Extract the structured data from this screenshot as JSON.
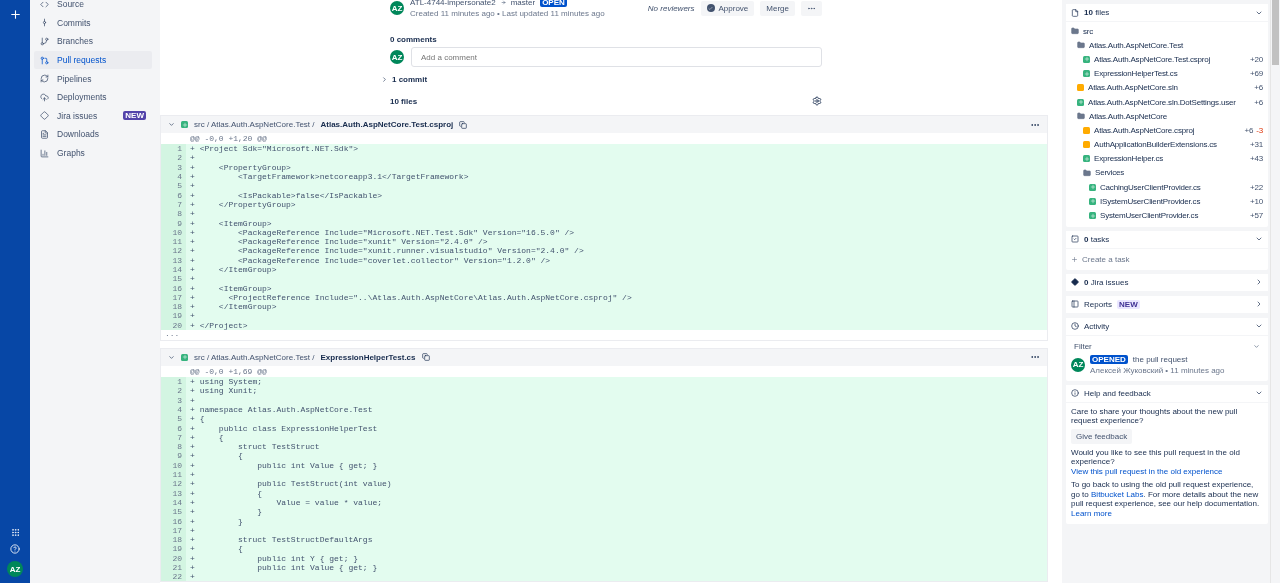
{
  "global_nav": {
    "avatar": "AZ"
  },
  "nav": {
    "items": [
      {
        "label": "Source",
        "selected": false
      },
      {
        "label": "Commits",
        "selected": false
      },
      {
        "label": "Branches",
        "selected": false
      },
      {
        "label": "Pull requests",
        "selected": true
      },
      {
        "label": "Pipelines",
        "selected": false
      },
      {
        "label": "Deployments",
        "selected": false
      },
      {
        "label": "Jira issues",
        "selected": false,
        "badge": "NEW"
      },
      {
        "label": "Downloads",
        "selected": false
      },
      {
        "label": "Graphs",
        "selected": false
      }
    ]
  },
  "pr": {
    "avatar": "AZ",
    "source_branch": "ATL-4744-impersonate2",
    "target_branch": "master",
    "status": "OPEN",
    "meta": "Created 11 minutes ago • Last updated 11 minutes ago",
    "reviewers": "No reviewers",
    "approve": "Approve",
    "merge": "Merge"
  },
  "comments": {
    "count": "0 comments",
    "avatar": "AZ",
    "placeholder": "Add a comment"
  },
  "commits": {
    "label": "1 commit",
    "expanded": false
  },
  "files_count": "10 files",
  "diffs": [
    {
      "breadcrumb": "src / Atlas.Auth.AspNetCore.Test /",
      "file": "Atlas.Auth.AspNetCore.Test.csproj",
      "expanded": true,
      "hunk": "@@ -0,0 +1,20 @@",
      "more": "...",
      "lines": [
        {
          "n": "1",
          "sign": "+",
          "code": "<Project Sdk=\"Microsoft.NET.Sdk\">"
        },
        {
          "n": "2",
          "sign": "+"
        },
        {
          "n": "3",
          "sign": "+",
          "code": "    <PropertyGroup>"
        },
        {
          "n": "4",
          "sign": "+",
          "code": "        <TargetFramework>netcoreapp3.1</TargetFramework>"
        },
        {
          "n": "5",
          "sign": "+"
        },
        {
          "n": "6",
          "sign": "+",
          "code": "        <IsPackable>false</IsPackable>"
        },
        {
          "n": "7",
          "sign": "+",
          "code": "    </PropertyGroup>"
        },
        {
          "n": "8",
          "sign": "+"
        },
        {
          "n": "9",
          "sign": "+",
          "code": "    <ItemGroup>"
        },
        {
          "n": "10",
          "sign": "+",
          "code": "        <PackageReference Include=\"Microsoft.NET.Test.Sdk\" Version=\"16.5.0\" />"
        },
        {
          "n": "11",
          "sign": "+",
          "code": "        <PackageReference Include=\"xunit\" Version=\"2.4.0\" />"
        },
        {
          "n": "12",
          "sign": "+",
          "code": "        <PackageReference Include=\"xunit.runner.visualstudio\" Version=\"2.4.0\" />"
        },
        {
          "n": "13",
          "sign": "+",
          "code": "        <PackageReference Include=\"coverlet.collector\" Version=\"1.2.0\" />"
        },
        {
          "n": "14",
          "sign": "+",
          "code": "    </ItemGroup>"
        },
        {
          "n": "15",
          "sign": "+"
        },
        {
          "n": "16",
          "sign": "+",
          "code": "    <ItemGroup>"
        },
        {
          "n": "17",
          "sign": "+",
          "code": "      <ProjectReference Include=\"..\\Atlas.Auth.AspNetCore\\Atlas.Auth.AspNetCore.csproj\" />"
        },
        {
          "n": "18",
          "sign": "+",
          "code": "    </ItemGroup>"
        },
        {
          "n": "19",
          "sign": "+"
        },
        {
          "n": "20",
          "sign": "+",
          "code": "</Project>"
        }
      ]
    },
    {
      "breadcrumb": "src / Atlas.Auth.AspNetCore.Test /",
      "file": "ExpressionHelperTest.cs",
      "expanded": true,
      "hunk": "@@ -0,0 +1,69 @@",
      "lines": [
        {
          "n": "1",
          "sign": "+",
          "code": "using System;"
        },
        {
          "n": "2",
          "sign": "+",
          "code": "using Xunit;"
        },
        {
          "n": "3",
          "sign": "+"
        },
        {
          "n": "4",
          "sign": "+",
          "code": "namespace Atlas.Auth.AspNetCore.Test"
        },
        {
          "n": "5",
          "sign": "+",
          "code": "{"
        },
        {
          "n": "6",
          "sign": "+",
          "code": "    public class ExpressionHelperTest"
        },
        {
          "n": "7",
          "sign": "+",
          "code": "    {"
        },
        {
          "n": "8",
          "sign": "+",
          "code": "        struct TestStruct"
        },
        {
          "n": "9",
          "sign": "+",
          "code": "        {"
        },
        {
          "n": "10",
          "sign": "+",
          "code": "            public int Value { get; }"
        },
        {
          "n": "11",
          "sign": "+"
        },
        {
          "n": "12",
          "sign": "+",
          "code": "            public TestStruct(int value)"
        },
        {
          "n": "13",
          "sign": "+",
          "code": "            {"
        },
        {
          "n": "14",
          "sign": "+",
          "code": "                Value = value * value;"
        },
        {
          "n": "15",
          "sign": "+",
          "code": "            }"
        },
        {
          "n": "16",
          "sign": "+",
          "code": "        }"
        },
        {
          "n": "17",
          "sign": "+"
        },
        {
          "n": "18",
          "sign": "+",
          "code": "        struct TestStructDefaultArgs"
        },
        {
          "n": "19",
          "sign": "+",
          "code": "        {"
        },
        {
          "n": "20",
          "sign": "+",
          "code": "            public int Y { get; }"
        },
        {
          "n": "21",
          "sign": "+",
          "code": "            public int Value { get; }"
        },
        {
          "n": "22",
          "sign": "+"
        }
      ]
    }
  ],
  "files_panel": {
    "title": "**10** files",
    "expanded": true,
    "tree": [
      {
        "name": "src",
        "kind": "folder",
        "children": [
          {
            "name": "Atlas.Auth.AspNetCore.Test",
            "kind": "folder",
            "children": [
              {
                "name": "Atlas.Auth.AspNetCore.Test.csproj",
                "kind": "added",
                "added": "+20"
              },
              {
                "name": "ExpressionHelperTest.cs",
                "kind": "added",
                "added": "+69"
              }
            ]
          },
          {
            "name": "Atlas.Auth.AspNetCore.sln",
            "kind": "modified",
            "added": "+6"
          },
          {
            "name": "Atlas.Auth.AspNetCore.sln.DotSettings.user",
            "kind": "added",
            "added": "+6"
          },
          {
            "name": "Atlas.Auth.AspNetCore",
            "kind": "folder",
            "children": [
              {
                "name": "Atlas.Auth.AspNetCore.csproj",
                "kind": "modified",
                "added": "+6",
                "removed": "-3"
              },
              {
                "name": "AuthApplicationBuilderExtensions.cs",
                "kind": "modified",
                "added": "+31"
              },
              {
                "name": "ExpressionHelper.cs",
                "kind": "added",
                "added": "+43"
              },
              {
                "name": "Services",
                "kind": "folder",
                "children": [
                  {
                    "name": "CachingUserClientProvider.cs",
                    "kind": "added",
                    "added": "+22"
                  },
                  {
                    "name": "ISystemUserClientProvider.cs",
                    "kind": "added",
                    "added": "+10"
                  },
                  {
                    "name": "SystemUserClientProvider.cs",
                    "kind": "added",
                    "added": "+57"
                  }
                ]
              }
            ]
          }
        ]
      }
    ]
  },
  "tasks_panel": {
    "title": "**0** tasks",
    "expanded": true,
    "create": "Create a task"
  },
  "jira_panel": {
    "title": "**0** Jira issues",
    "expanded": false
  },
  "reports_panel": {
    "title": "Reports",
    "badge": "NEW",
    "expanded": false
  },
  "activity_panel": {
    "title": "Activity",
    "expanded": true,
    "filter": "Filter",
    "events": [
      {
        "avatar": "AZ",
        "badge": "OPENED",
        "text": "the pull request",
        "meta": "Алексей Жуковский • 11 minutes ago"
      }
    ]
  },
  "help_panel": {
    "title": "Help and feedback",
    "expanded": true,
    "prompt": "Care to share your thoughts about the new pull request experience?",
    "feedback": "Give feedback",
    "old_question": "Would you like to see this pull request in the old experience?",
    "old_link": "View this pull request in the old experience",
    "back_before": "To go back to using the old pull request experience, go to",
    "labs_link": "Bitbucket Labs",
    "back_after": ". For more details about the new pull request experience, see our help documentation.",
    "learn_link": "Learn more"
  }
}
